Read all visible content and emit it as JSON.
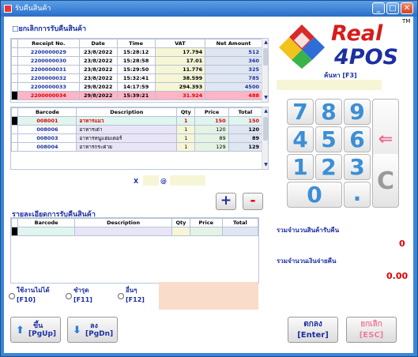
{
  "window": {
    "title": "รับคืนสินค้า",
    "min_glyph": "_",
    "max_glyph": "□",
    "close_glyph": "✕"
  },
  "cancel_return": {
    "checkbox": "□",
    "label": "ยกเลิกการรับคืนสินค้า"
  },
  "receipts": {
    "columns": [
      "Receipt No.",
      "Date",
      "Time",
      "VAT",
      "Net Amount"
    ],
    "rows": [
      [
        "2200000029",
        "23/8/2022",
        "15:28:12",
        "17.794",
        "512"
      ],
      [
        "2200000030",
        "23/8/2022",
        "15:28:58",
        "17.01",
        "360"
      ],
      [
        "2200000031",
        "23/8/2022",
        "15:29:50",
        "11.776",
        "325"
      ],
      [
        "2200000032",
        "23/8/2022",
        "15:32:41",
        "38.599",
        "785"
      ],
      [
        "2200000033",
        "29/8/2022",
        "14:17:59",
        "294.393",
        "4500"
      ],
      [
        "2200000034",
        "29/8/2022",
        "15:39:21",
        "31.924",
        "488"
      ]
    ]
  },
  "items": {
    "columns": [
      "Barcode",
      "Description",
      "Qty",
      "Price",
      "Total"
    ],
    "rows": [
      [
        "008001",
        "อาหารแมว",
        "1",
        "150",
        "150"
      ],
      [
        "008006",
        "อาหารเต่า",
        "1",
        "120",
        "120"
      ],
      [
        "008003",
        "อาหารหนูแฮมเตอร์",
        "1",
        "89",
        "89"
      ],
      [
        "008004",
        "อาหารกระต่าย",
        "1",
        "129",
        "129"
      ]
    ]
  },
  "calc": {
    "x_label": "X",
    "at_label": "@"
  },
  "plus_label": "+",
  "minus_label": "-",
  "return_details": {
    "label": "รายละเอียดการรับคืนสินค้า",
    "columns": [
      "Barcode",
      "Description",
      "Qty",
      "Price",
      "Total"
    ]
  },
  "logo": {
    "line1": "Real",
    "line2": "4POS",
    "tm": "TM"
  },
  "search": {
    "label": "ค้นหา [F3]"
  },
  "keypad": {
    "k7": "7",
    "k8": "8",
    "k9": "9",
    "k4": "4",
    "k5": "5",
    "k6": "6",
    "k1": "1",
    "k2": "2",
    "k3": "3",
    "k0": "0",
    "dot": ".",
    "backspace": "⇐",
    "clear": "C"
  },
  "totals": {
    "qty_label": "รวมจำนวนสินค้ารับคืน",
    "qty_value": "0",
    "amount_label": "รวมจำนวนเงินจ่ายคืน",
    "amount_value": "0.00"
  },
  "reasons": [
    {
      "label": "ใช้งานไม่ได้",
      "key": "[F10]"
    },
    {
      "label": "ชำรุด",
      "key": "[F11]"
    },
    {
      "label": "อื่นๆ",
      "key": "[F12]"
    }
  ],
  "nav": {
    "up_label": "ขึ้น",
    "up_key": "[PgUp]",
    "down_label": "ลง",
    "down_key": "[PgDn]",
    "up_arrow": "⬆",
    "down_arrow": "⬇"
  },
  "actions": {
    "ok_label": "ตกลง",
    "ok_key": "[Enter]",
    "cancel_label": "ยกเลิก",
    "cancel_key": "[ESC]"
  },
  "colors": {
    "accent": "#1c2fa0",
    "selected_row": "#ffb5c5",
    "red": "#e00000",
    "keypad_text": "#3b8fd6"
  }
}
